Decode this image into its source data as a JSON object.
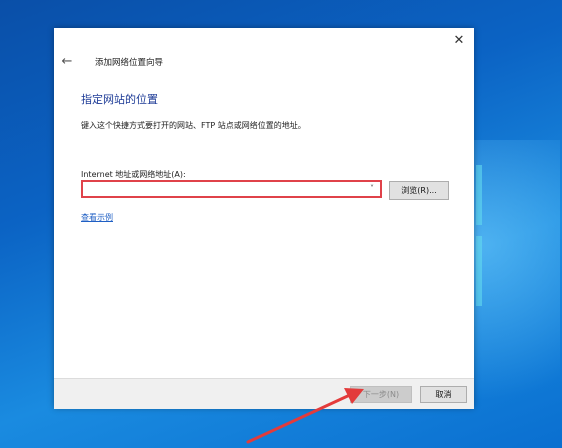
{
  "dialog": {
    "close_icon": "close-icon",
    "back_icon": "back-arrow-icon",
    "title": "添加网络位置向导",
    "heading": "指定网站的位置",
    "description": "键入这个快捷方式要打开的网站、FTP 站点或网络位置的地址。",
    "field_label": "Internet 地址或网络地址(A):",
    "address_value": "",
    "browse_label": "浏览(R)...",
    "example_link": "查看示例",
    "next_label": "下一步(N)",
    "cancel_label": "取消"
  },
  "colors": {
    "desktop": "#0b63c4",
    "heading": "#1c3a96",
    "highlight_border": "#e0424a",
    "annotation_arrow": "#e33b3b",
    "link": "#1f5fc4"
  }
}
